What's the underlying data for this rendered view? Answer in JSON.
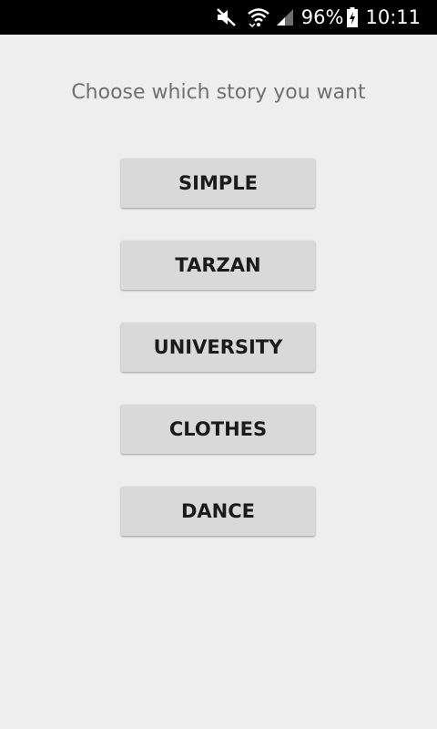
{
  "status_bar": {
    "battery_percent": "96%",
    "time": "10:11",
    "icons": [
      "mute-icon",
      "wifi-icon",
      "signal-icon",
      "battery-charging-icon"
    ]
  },
  "main": {
    "prompt": "Choose which story you want",
    "buttons": [
      {
        "label": "SIMPLE"
      },
      {
        "label": "TARZAN"
      },
      {
        "label": "UNIVERSITY"
      },
      {
        "label": "CLOTHES"
      },
      {
        "label": "DANCE"
      }
    ]
  },
  "colors": {
    "background": "#eeeeee",
    "status_bar": "#000000",
    "button": "#d9d9d9",
    "button_text": "#1b1b1b",
    "prompt_text": "#707070"
  }
}
